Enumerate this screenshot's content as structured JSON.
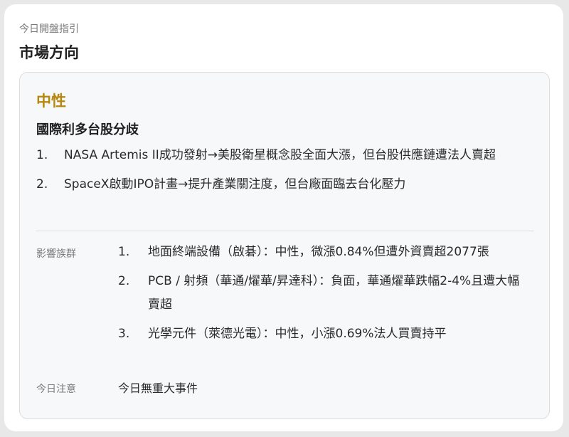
{
  "header": {
    "subtitle": "今日開盤指引",
    "title": "市場方向"
  },
  "summary": {
    "sentiment": "中性",
    "sentiment_color": "#b8860b",
    "headline": "國際利多台股分歧",
    "news": [
      {
        "num": "1.",
        "text": "NASA Artemis II成功發射→美股衛星概念股全面大漲，但台股供應鏈遭法人賣超"
      },
      {
        "num": "2.",
        "text": "SpaceX啟動IPO計畫→提升產業關注度，但台廠面臨去台化壓力"
      }
    ]
  },
  "impact": {
    "label": "影響族群",
    "items": [
      {
        "num": "1.",
        "text": "地面終端設備（啟碁）：中性，微漲0.84%但遭外資賣超2077張"
      },
      {
        "num": "2.",
        "text": "PCB / 射頻（華通/燿華/昇達科）：負面，華通燿華跌幅2-4%且遭大幅賣超"
      },
      {
        "num": "3.",
        "text": "光學元件（萊德光電）：中性，小漲0.69%法人買賣持平"
      }
    ]
  },
  "notes": {
    "label": "今日注意",
    "value": "今日無重大事件"
  }
}
